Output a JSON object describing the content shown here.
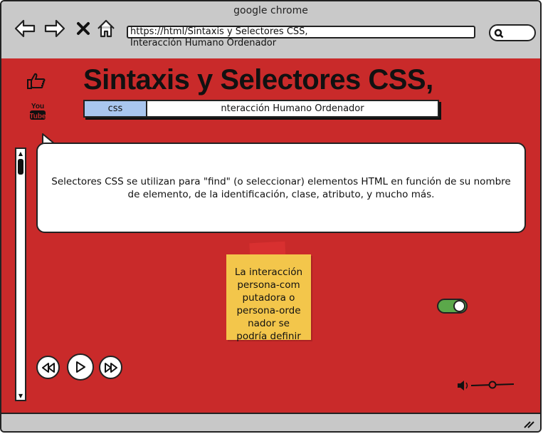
{
  "window": {
    "title": "google chrome"
  },
  "browser": {
    "url": "https://html/Sintaxis y Selectores CSS,\nInteracción Humano Ordenador",
    "icons": [
      "back-arrow-icon",
      "forward-arrow-icon",
      "close-x-icon",
      "home-icon",
      "search-icon"
    ]
  },
  "page": {
    "title": "Sintaxis y Selectores CSS,",
    "tabs": [
      {
        "label": "css",
        "active": true
      },
      {
        "label": "nteracción Humano Ordenador",
        "active": false
      }
    ],
    "side_icons": [
      "thumbs-up-icon",
      "youtube-icon"
    ],
    "youtube_text": {
      "top": "You",
      "bottom": "Tube"
    },
    "bubble_text": "Selectores CSS se utilizan para \"find\" (o seleccionar) elementos HTML en función de su nombre de elemento, de la identificación, clase, atributo, y mucho más.",
    "sticky_note": "La interacción persona-com putadora o persona-orde nador se podría definir",
    "toggle": {
      "on": true,
      "color": "#5ba84a"
    },
    "media_controls": [
      "rewind-icon",
      "play-icon",
      "fast-forward-icon"
    ],
    "volume_icon": "speaker-icon"
  },
  "colors": {
    "background": "#c92a2a",
    "tab_active": "#a9c6ef",
    "sticky": "#f3c64b",
    "chrome": "#c8c8c8"
  }
}
